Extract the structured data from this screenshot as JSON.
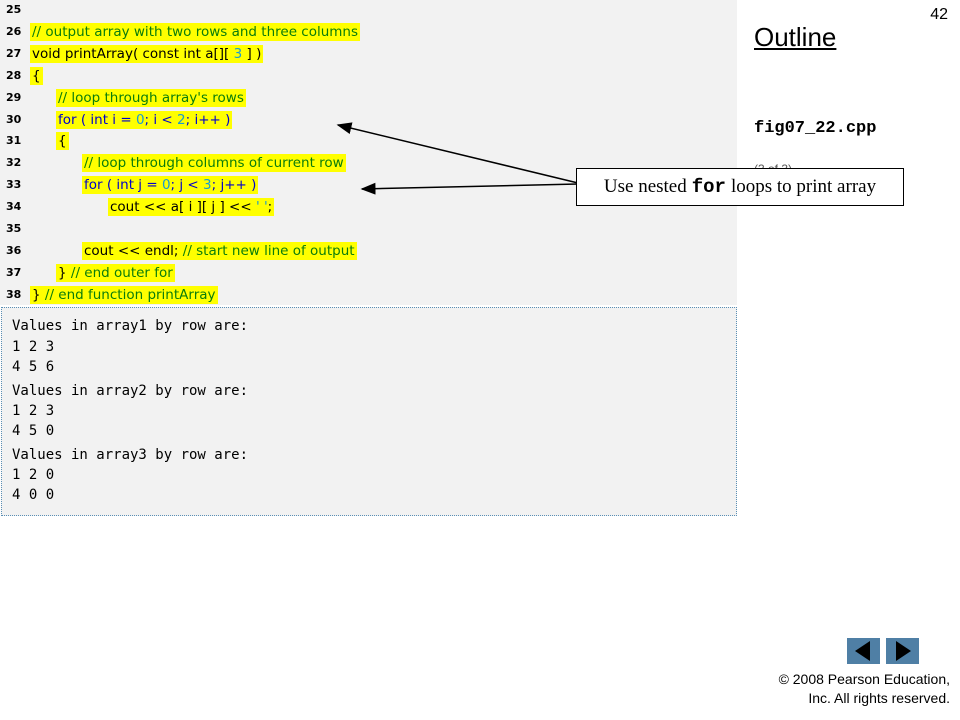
{
  "slide": {
    "page_number": "42",
    "outline_title": "Outline",
    "file_name": "fig07_22.cpp",
    "page_of": "(3 of 3)"
  },
  "code_lines": [
    {
      "no": "25",
      "segments": []
    },
    {
      "no": "26",
      "segments": [
        {
          "t": "// output array with two rows and three columns",
          "c": "com"
        }
      ]
    },
    {
      "no": "27",
      "segments": [
        {
          "t": "void printArray( const int a[][ ",
          "c": "txt"
        },
        {
          "t": "3",
          "c": "num"
        },
        {
          "t": " ] )",
          "c": "txt"
        }
      ]
    },
    {
      "no": "28",
      "segments": [
        {
          "t": "{",
          "c": "txt"
        }
      ]
    },
    {
      "no": "29",
      "segments": [
        {
          "t": "// loop through array's rows",
          "c": "com"
        }
      ]
    },
    {
      "no": "30",
      "segments": [
        {
          "t": "for ( int i = ",
          "c": "kw"
        },
        {
          "t": "0",
          "c": "num"
        },
        {
          "t": "; i < ",
          "c": "kw"
        },
        {
          "t": "2",
          "c": "num"
        },
        {
          "t": "; i++ )",
          "c": "kw"
        }
      ]
    },
    {
      "no": "31",
      "segments": [
        {
          "t": "{",
          "c": "txt"
        }
      ]
    },
    {
      "no": "32",
      "segments": [
        {
          "t": "// loop through columns of current row",
          "c": "com"
        }
      ]
    },
    {
      "no": "33",
      "segments": [
        {
          "t": "for ( int j = ",
          "c": "kw"
        },
        {
          "t": "0",
          "c": "num"
        },
        {
          "t": "; j < ",
          "c": "kw"
        },
        {
          "t": "3",
          "c": "num"
        },
        {
          "t": "; j++ )",
          "c": "kw"
        }
      ]
    },
    {
      "no": "34",
      "segments": [
        {
          "t": "cout << a[ i ][ j ] << ",
          "c": "txt"
        },
        {
          "t": "' '",
          "c": "num"
        },
        {
          "t": ";",
          "c": "txt"
        }
      ]
    },
    {
      "no": "35",
      "segments": []
    },
    {
      "no": "36",
      "segments": [
        {
          "t": "cout << endl; ",
          "c": "txt"
        },
        {
          "t": "// start new line of output",
          "c": "com"
        }
      ]
    },
    {
      "no": "37",
      "segments": [
        {
          "t": "} ",
          "c": "txt"
        },
        {
          "t": "// end outer for",
          "c": "com"
        }
      ]
    },
    {
      "no": "38",
      "segments": [
        {
          "t": "} ",
          "c": "txt"
        },
        {
          "t": "// end function printArray",
          "c": "com"
        }
      ]
    }
  ],
  "output_lines": [
    "Values in array1 by row are:",
    "1 2 3",
    "4 5 6",
    "Values in array2 by row are:",
    "1 2 3",
    "4 5 0",
    "Values in array3 by row are:",
    "1 2 0",
    "4 0 0"
  ],
  "callout": {
    "before": "Use nested",
    "code": "for",
    "after": "loops to print array"
  },
  "nav": {
    "prev_icon": "triangle-left-icon",
    "next_icon": "triangle-right-icon"
  },
  "copyright": {
    "line1": "© 2008 Pearson Education,",
    "line2": "Inc.  All rights reserved."
  },
  "colors": {
    "highlight": "#ffff00",
    "comment": "#0b7d0b",
    "keyword": "#0000cc",
    "number": "#1a9bd0",
    "nav_button": "#4f7fa5"
  }
}
